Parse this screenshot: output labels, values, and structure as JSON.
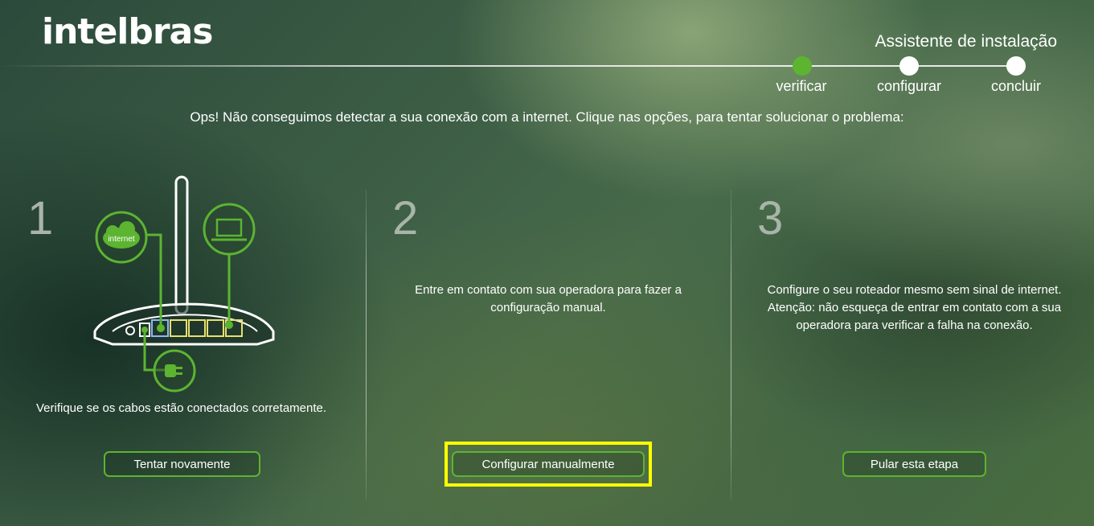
{
  "header": {
    "logo": "intelbras",
    "wizard_title": "Assistente de instalação"
  },
  "steps": [
    {
      "label": "verificar",
      "active": true
    },
    {
      "label": "configurar",
      "active": false
    },
    {
      "label": "concluir",
      "active": false
    }
  ],
  "message": "Ops! Não conseguimos detectar a sua conexão com a internet. Clique nas opções, para tentar solucionar o problema:",
  "columns": [
    {
      "number": "1",
      "text": "Verifique se os cabos estão conectados corretamente.",
      "button": "Tentar novamente",
      "illustration_label": "internet"
    },
    {
      "number": "2",
      "text_line1": "Entre em contato com sua operadora para fazer a",
      "text_line2": "configuração manual.",
      "button": "Configurar manualmente"
    },
    {
      "number": "3",
      "text_line1": "Configure o seu roteador mesmo sem sinal de internet.",
      "text_line2": "Atenção: não esqueça de entrar em contato com a sua",
      "text_line3": "operadora para verificar a falha na conexão.",
      "button": "Pular esta etapa"
    }
  ],
  "colors": {
    "accent": "#5cb431",
    "highlight": "#ffff00",
    "number": "#a8b5a8"
  }
}
